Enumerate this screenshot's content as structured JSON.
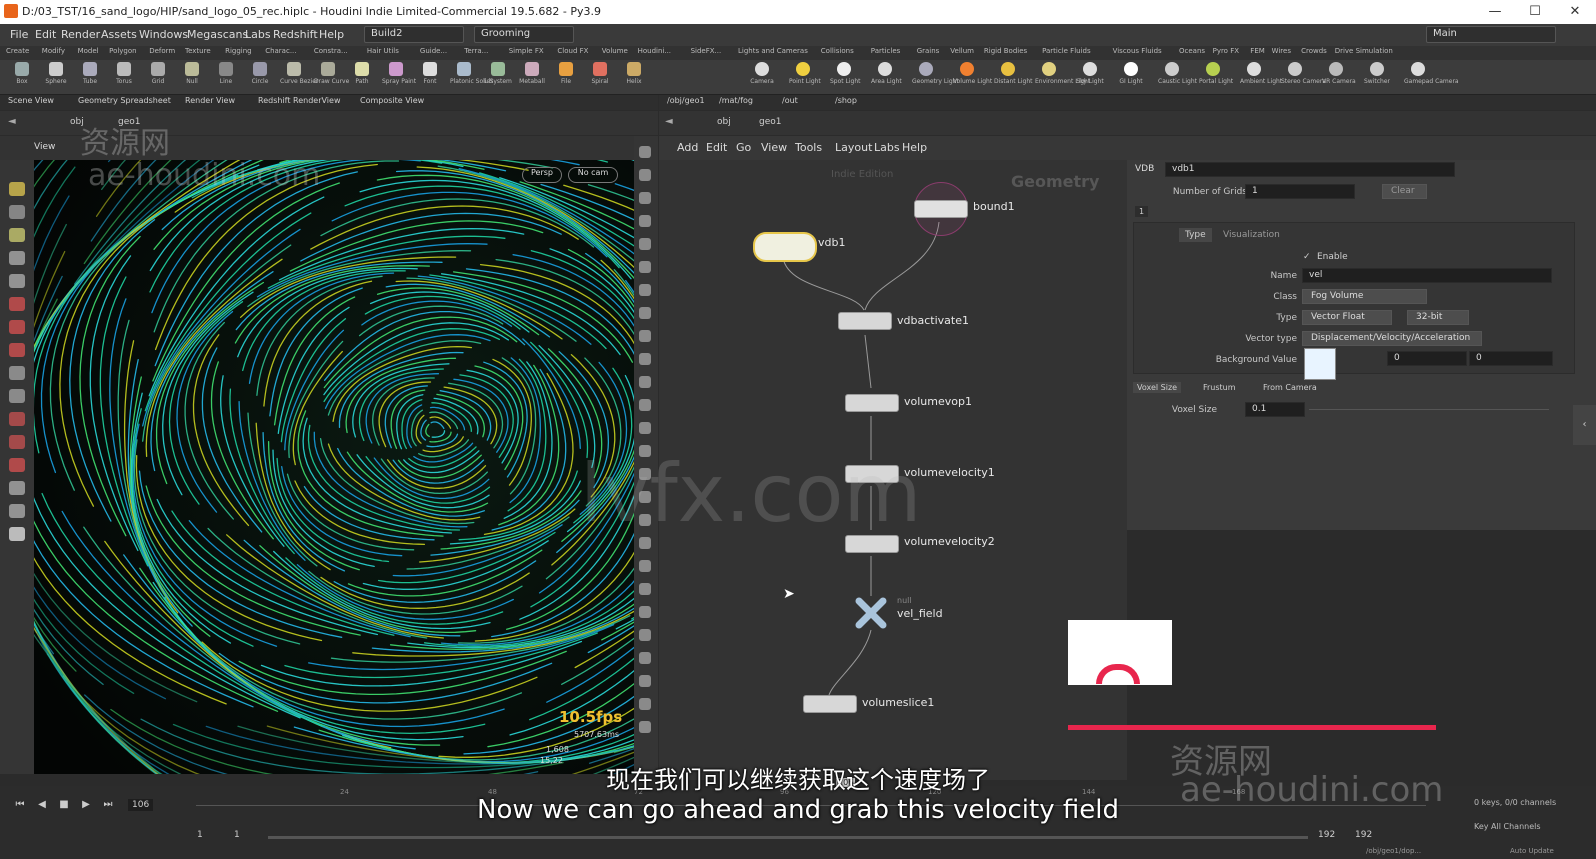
{
  "titlebar": {
    "title": "D:/03_TST/16_sand_logo/HIP/sand_logo_05_rec.hiplc - Houdini Indie Limited-Commercial 19.5.682 - Py3.9",
    "minimize": "—",
    "maximize": "☐",
    "close": "✕"
  },
  "menubar": {
    "items": [
      "File",
      "Edit",
      "Render",
      "Assets",
      "Windows",
      "Megascans",
      "Labs",
      "Redshift",
      "Help"
    ],
    "build": "Build2",
    "desktop": "Grooming",
    "main": "Main"
  },
  "shelf": {
    "tabs_left": [
      "Create",
      "Modify",
      "Model",
      "Polygon",
      "Deform",
      "Texture",
      "Rigging",
      "Charac...",
      "Constra...",
      "Hair Utils",
      "Guide...",
      "Terra...",
      "Simple FX",
      "Cloud FX",
      "Volume",
      "Houdini...",
      "SideFX..."
    ],
    "tabs_right": [
      "Lights and Cameras",
      "Collisions",
      "Particles",
      "Grains",
      "Vellum",
      "Rigid Bodies",
      "Particle Fluids",
      "Viscous Fluids",
      "Oceans",
      "Pyro FX",
      "FEM",
      "Wires",
      "Crowds",
      "Drive Simulation"
    ],
    "tools_left": [
      "Box",
      "Sphere",
      "Tube",
      "Torus",
      "Grid",
      "Null",
      "Line",
      "Circle",
      "Curve Bezier",
      "Draw Curve",
      "Path",
      "Spray Paint",
      "Font",
      "Platonic Solids",
      "L-System",
      "Metaball",
      "File",
      "Spiral",
      "Helix"
    ],
    "tools_right": [
      "Camera",
      "Point Light",
      "Spot Light",
      "Area Light",
      "Geometry Light",
      "Volume Light",
      "Distant Light",
      "Environment Light",
      "Sky Light",
      "GI Light",
      "Caustic Light",
      "Portal Light",
      "Ambient Light",
      "Stereo Camera",
      "VR Camera",
      "Switcher",
      "Gamepad Camera"
    ]
  },
  "left_pane": {
    "tabs": [
      "Scene View",
      "Geometry Spreadsheet",
      "Render View",
      "Redshift RenderView",
      "Composite View"
    ],
    "path": [
      "obj",
      "geo1"
    ],
    "view_label": "View",
    "persp": "Persp",
    "cam": "No cam",
    "fps": "10.5fps",
    "ms": "5707.63ms",
    "stats1": "1,608",
    "stats2": "15,22"
  },
  "right_pane": {
    "tabs": [
      "/obj/geo1",
      "/mat/fog",
      "/out",
      "/shop"
    ],
    "path": [
      "obj",
      "geo1"
    ],
    "menu": [
      "Add",
      "Edit",
      "Go",
      "View",
      "Tools",
      "Layout",
      "Labs",
      "Help"
    ],
    "context": "Geometry",
    "nodes": {
      "bound1": "bound1",
      "vdb1": "vdb1",
      "vdbactivate1": "vdbactivate1",
      "volumevop1": "volumevop1",
      "volumevelocity1": "volumevelocity1",
      "volumevelocity2": "volumevelocity2",
      "vel_field": "vel_field",
      "null_small": "null",
      "volumeslice1": "volumeslice1",
      "ghost": "Indie Edition"
    }
  },
  "params": {
    "node_type": "VDB",
    "node_name": "vdb1",
    "number_of_grids_label": "Number of Grids",
    "number_of_grids": "1",
    "clear": "Clear",
    "index": "1",
    "tabs": [
      "Type",
      "Visualization"
    ],
    "enable": "Enable",
    "name_label": "Name",
    "name": "vel",
    "class_label": "Class",
    "class": "Fog Volume",
    "type_label": "Type",
    "type": "Vector Float",
    "bits": "32-bit",
    "vector_type_label": "Vector type",
    "vector_type": "Displacement/Velocity/Acceleration",
    "bg_label": "Background Value",
    "bg_values": [
      "0",
      "0"
    ],
    "radio": [
      "Voxel Size",
      "Frustum",
      "From Camera"
    ],
    "voxel_size_label": "Voxel Size",
    "voxel_size": "0.1"
  },
  "timeline": {
    "frame": "106",
    "start": "1",
    "start2": "1",
    "end": "192",
    "end2": "192",
    "marker": "106",
    "ticks": [
      "24",
      "48",
      "72",
      "96",
      "120",
      "144",
      "168"
    ],
    "keys": "0 keys, 0/0 channels",
    "key_all": "Key All Channels",
    "path_bottom": "/obj/geo1/dop...",
    "auto_update": "Auto Update"
  },
  "subtitles": {
    "zh": "现在我们可以继续获取这个速度场了",
    "en": "Now we can go ahead and grab this velocity field"
  },
  "watermarks": {
    "cn": "资源网",
    "site": "ae-houdini.com",
    "center": "lvfx.com"
  },
  "colors": {
    "accent_red": "#e8264d",
    "node_yellow": "#e6c64a",
    "node_bound": "#b8508c"
  }
}
